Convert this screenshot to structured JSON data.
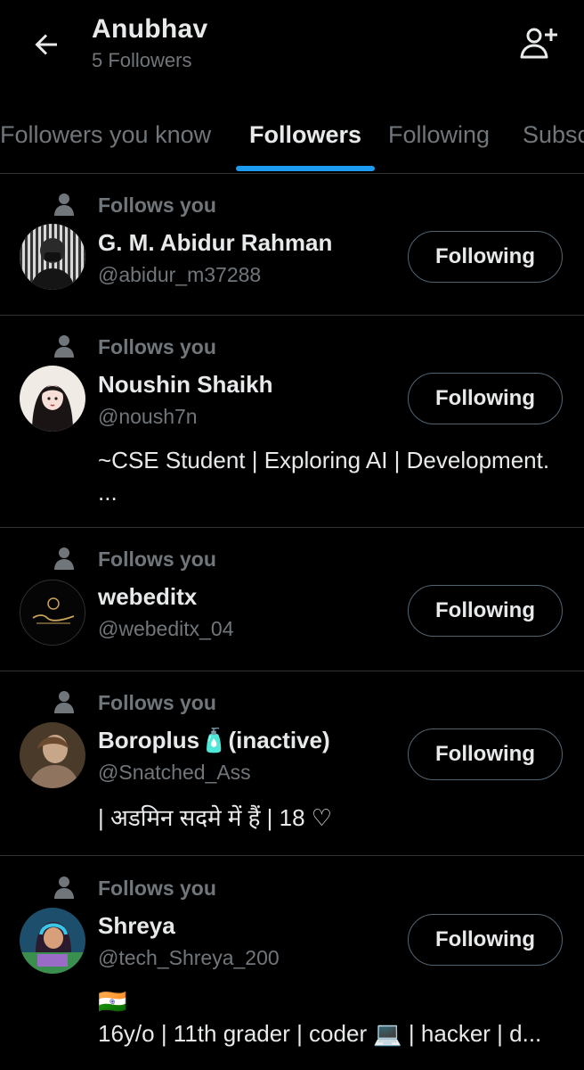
{
  "header": {
    "title": "Anubhav",
    "subtitle": "5 Followers"
  },
  "tabs": [
    {
      "label": "Followers you know",
      "active": false
    },
    {
      "label": "Followers",
      "active": true
    },
    {
      "label": "Following",
      "active": false
    },
    {
      "label": "Subscriptions",
      "active": false
    }
  ],
  "users": [
    {
      "follows_label": "Follows you",
      "name": "G. M. Abidur Rahman",
      "handle": "@abidur_m37288",
      "bio": "",
      "button": "Following"
    },
    {
      "follows_label": "Follows you",
      "name": "Noushin Shaikh",
      "handle": "@noush7n",
      "bio": "~CSE Student | Exploring AI | Development. ...",
      "button": "Following"
    },
    {
      "follows_label": "Follows you",
      "name": "webeditx",
      "handle": "@webeditx_04",
      "bio": "",
      "button": "Following"
    },
    {
      "follows_label": "Follows you",
      "name": "Boroplus🧴(inactive)",
      "handle": "@Snatched_Ass",
      "bio": "| अडमिन सदमे में हैं  | 18 ♡",
      "button": "Following"
    },
    {
      "follows_label": "Follows you",
      "name": "Shreya",
      "handle": "@tech_Shreya_200",
      "bio_line1": "🇮🇳",
      "bio_line2": "16y/o | 11th grader | coder 💻 | hacker | d...",
      "button": "Following"
    }
  ],
  "colors": {
    "background": "#000000",
    "text": "#e7e9ea",
    "secondary": "#71767b",
    "accent": "#1d9bf0",
    "border": "#2f3336"
  }
}
